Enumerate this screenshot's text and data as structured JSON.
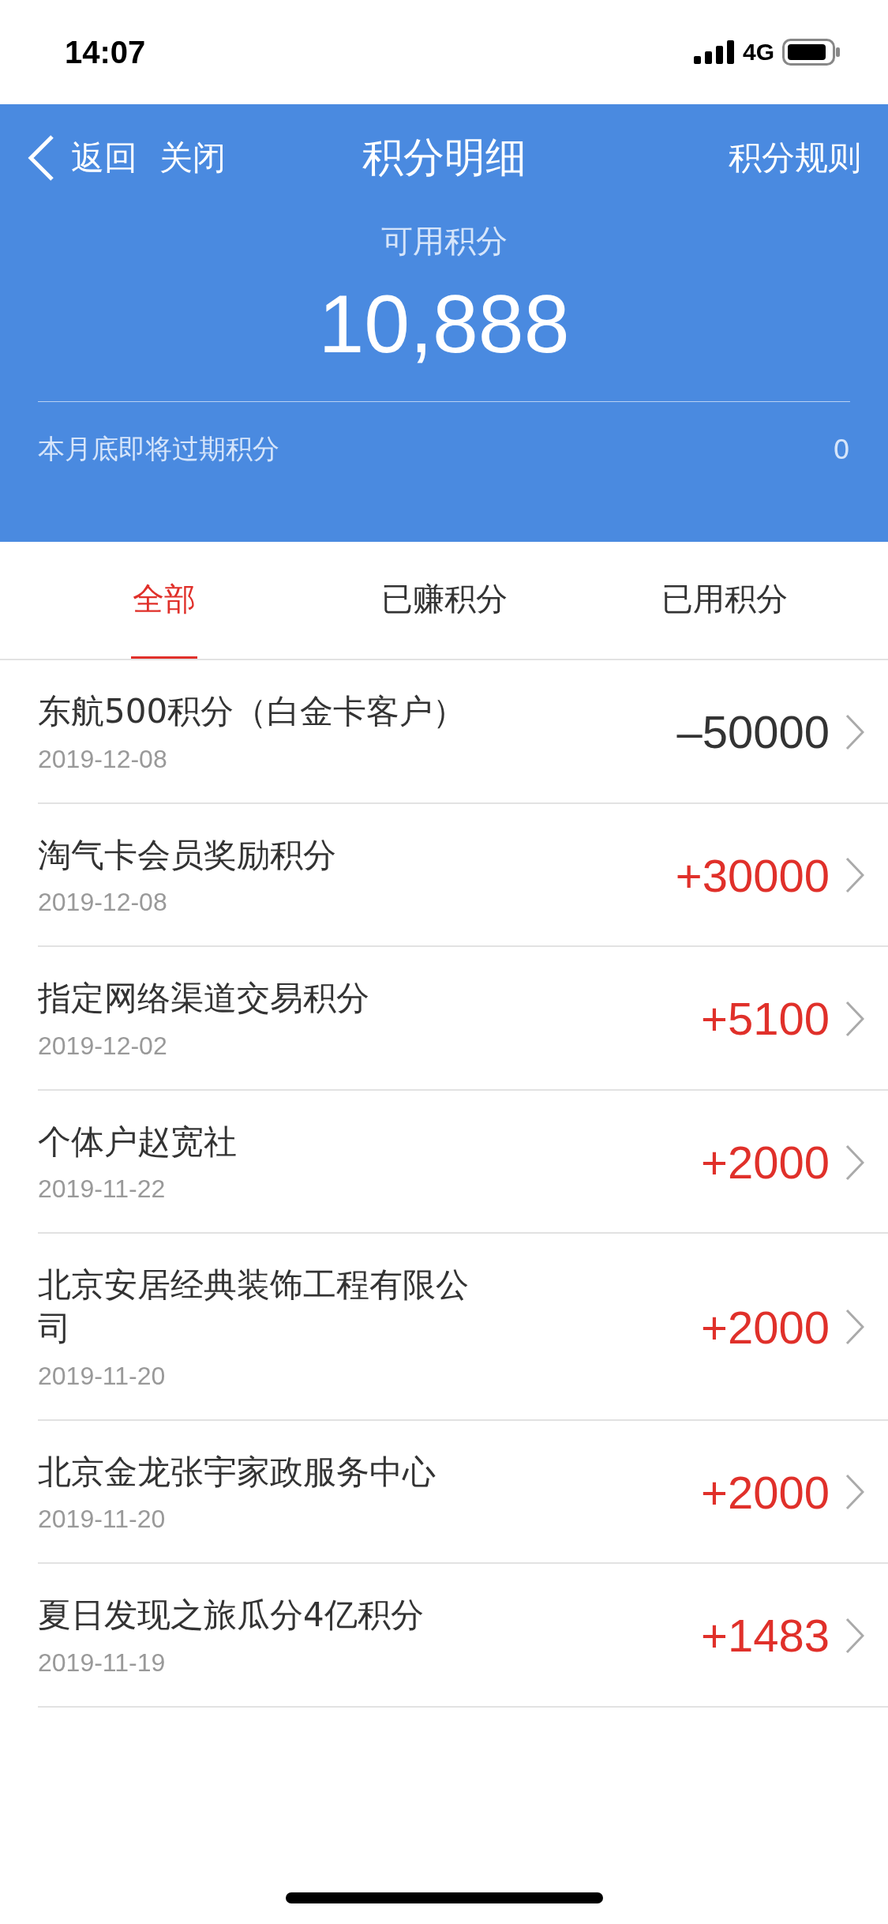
{
  "status_bar": {
    "time": "14:07",
    "network": "4G"
  },
  "header": {
    "back": "返回",
    "close": "关闭",
    "title": "积分明细",
    "rules": "积分规则",
    "balance_label": "可用积分",
    "balance": "10,888",
    "expiring_label": "本月底即将过期积分",
    "expiring_value": "0"
  },
  "tabs": [
    {
      "label": "全部",
      "selected": true
    },
    {
      "label": "已赚积分",
      "selected": false
    },
    {
      "label": "已用积分",
      "selected": false
    }
  ],
  "records": [
    {
      "title": "东航500积分（白金卡客户）",
      "date": "2019-12-08",
      "amount": "–50000",
      "kind": "debit"
    },
    {
      "title": "淘气卡会员奖励积分",
      "date": "2019-12-08",
      "amount": "+30000",
      "kind": "credit"
    },
    {
      "title": "指定网络渠道交易积分",
      "date": "2019-12-02",
      "amount": "+5100",
      "kind": "credit"
    },
    {
      "title": "个体户赵宽社",
      "date": "2019-11-22",
      "amount": "+2000",
      "kind": "credit"
    },
    {
      "title": "北京安居经典装饰工程有限公司",
      "date": "2019-11-20",
      "amount": "+2000",
      "kind": "credit"
    },
    {
      "title": "北京金龙张宇家政服务中心",
      "date": "2019-11-20",
      "amount": "+2000",
      "kind": "credit"
    },
    {
      "title": "夏日发现之旅瓜分4亿积分",
      "date": "2019-11-19",
      "amount": "+1483",
      "kind": "credit"
    }
  ]
}
